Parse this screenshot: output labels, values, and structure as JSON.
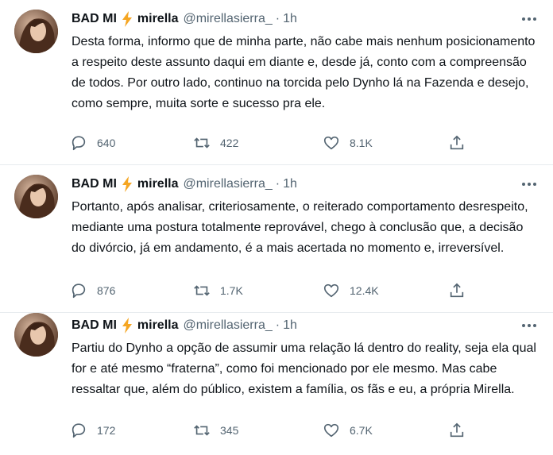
{
  "tweets": [
    {
      "display_name": "BAD MI",
      "emoji_icon": "high-voltage-icon",
      "name": "mirella",
      "handle": "@mirellasierra_",
      "separator": "·",
      "time": "1h",
      "text": "Desta forma, informo que de minha parte, não cabe mais nenhum posicionamento a respeito deste assunto daqui em diante e, desde já, conto com a compreensão de todos.  Por outro lado, continuo na torcida pelo Dynho lá na Fazenda e desejo, como sempre, muita sorte e sucesso pra ele.",
      "replies": "640",
      "retweets": "422",
      "likes": "8.1K"
    },
    {
      "display_name": "BAD MI",
      "emoji_icon": "high-voltage-icon",
      "name": "mirella",
      "handle": "@mirellasierra_",
      "separator": "·",
      "time": "1h",
      "text": "Portanto, após analisar, criteriosamente, o reiterado comportamento desrespeito, mediante uma postura totalmente reprovável, chego à conclusão que, a decisão do divórcio, já em andamento, é a mais acertada no momento e, irreversível.",
      "replies": "876",
      "retweets": "1.7K",
      "likes": "12.4K"
    },
    {
      "display_name": "BAD MI",
      "emoji_icon": "high-voltage-icon",
      "name": "mirella",
      "handle": "@mirellasierra_",
      "separator": "·",
      "time": "1h",
      "text": "Partiu do Dynho a opção de assumir uma relação lá dentro do reality, seja ela qual for e até mesmo “fraterna”, como foi mencionado por ele mesmo. Mas cabe ressaltar que, além do público, existem a família, os fãs e eu, a própria Mirella.",
      "replies": "172",
      "retweets": "345",
      "likes": "6.7K"
    }
  ],
  "colors": {
    "text": "#0f1419",
    "secondary": "#536471",
    "divider": "#e7ebee",
    "bolt": "#f5a623"
  }
}
